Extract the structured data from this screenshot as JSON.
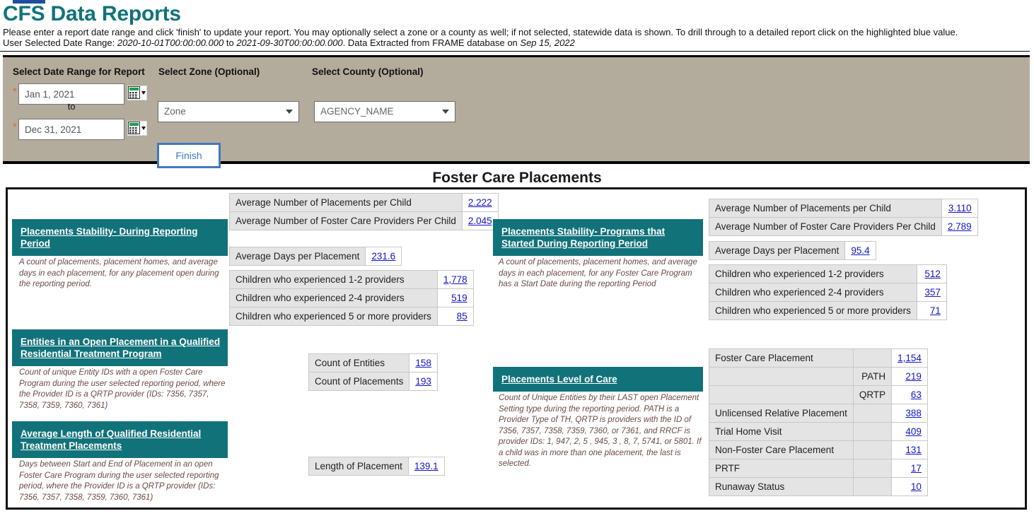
{
  "header": {
    "title": "CFS Data Reports",
    "instructions": "Please enter a report date range and click 'finish' to update your report. You may optionally select a zone or a county as well; if not selected, statewide data is shown. To drill through to a detailed report click on the highlighted blue value.",
    "date_range_prefix": "User Selected Date Range: ",
    "date_range_start": "2020-10-01T00:00:00.000",
    "date_range_joiner": " to ",
    "date_range_end": "2021-09-30T00:00:00.000",
    "extract_prefix": ". Data Extracted from FRAME database on ",
    "extract_date": "Sep 15, 2022",
    "title_color": "#11727a"
  },
  "params": {
    "date_range_label": "Select Date Range for Report",
    "zone_label": "Select Zone (Optional)",
    "county_label": "Select County (Optional)",
    "required_marker": "*",
    "start_date_value": "Jan 1, 2021",
    "start_date_placeholder": "Jan 1, 2021",
    "to_label": "to",
    "end_date_value": "Dec 31, 2021",
    "end_date_placeholder": "Dec 31, 2021",
    "zone_selected": "Zone",
    "county_selected": "AGENCY_NAME",
    "finish_label": "Finish",
    "calendar_icon": "calendar-icon",
    "panel_color": "#b3ab9b",
    "finish_border_color": "#4478be"
  },
  "report": {
    "title": "Foster Care Placements"
  },
  "sections": {
    "stability_during": {
      "heading": "Placements Stability- During Reporting Period",
      "description": "A count of placements, placement homes, and average days in each placement, for any placement open during the reporting period.",
      "avg_table": [
        {
          "label": "Average Number of Placements per Child",
          "value": "2.222"
        },
        {
          "label": "Average Number of Foster Care Providers Per Child",
          "value": "2.045"
        }
      ],
      "days_label": "Average Days per Placement",
      "days_value": "231.6",
      "providers_table": [
        {
          "label": "Children who experienced 1-2 providers",
          "value": "1,778"
        },
        {
          "label": "Children who experienced 2-4 providers",
          "value": "519"
        },
        {
          "label": "Children who experienced 5 or more providers",
          "value": "85"
        }
      ]
    },
    "stability_started": {
      "heading": "Placements Stability- Programs that Started During Reporting Period",
      "description": "A count of placements, placement homes, and average days in each placement, for any Foster Care Program  has a Start Date during the reporting Period",
      "avg_table": [
        {
          "label": "Average Number of Placements per Child",
          "value": "3.110"
        },
        {
          "label": "Average Number of Foster Care Providers Per Child",
          "value": "2.789"
        }
      ],
      "days_label": "Average Days per Placement",
      "days_value": "95.4",
      "providers_table": [
        {
          "label": "Children who experienced 1-2 providers",
          "value": "512"
        },
        {
          "label": "Children who experienced 2-4 providers",
          "value": "357"
        },
        {
          "label": "Children who experienced 5 or more providers",
          "value": "71"
        }
      ]
    },
    "qrtp_entities": {
      "heading": "Entities in an Open Placement in a Qualified Residential Treatment Program",
      "description": "Count of unique Entity IDs with a open Foster Care Program during the user selected reporting period, where the Provider ID is a QRTP provider (IDs: 7356, 7357, 7358, 7359, 7360, 7361)",
      "table": [
        {
          "label": "Count of Entities",
          "value": "158"
        },
        {
          "label": "Count of Placements",
          "value": "193"
        }
      ]
    },
    "qrtp_length": {
      "heading": "Average Length of Qualified Residential Treatment Placements",
      "description": "Days between Start and End of Placement in an open Foster Care Program during the user selected reporting period, where the Provider ID is a QRTP provider (IDs: 7356, 7357, 7358, 7359, 7360, 7361)",
      "label": "Length of Placement",
      "value": "139.1"
    },
    "level_of_care": {
      "heading": "Placements Level of Care",
      "description": "Count of Unique Entities by their LAST open Placement Setting type during the reporting period. PATH is a Provider Type of TH, QRTP is providers with the ID of 7356, 7357, 7358, 7359, 7360, or 7361, and RRCF is provider IDs: 1, 947, 2, 5 , 945, 3 , 8, 7, 5741, or 5801. If a child was in more than one placement, the last is selected.",
      "rows": [
        {
          "label": "Foster Care Placement",
          "sub": "",
          "value": "1,154"
        },
        {
          "label": "",
          "sub": "PATH",
          "value": "219"
        },
        {
          "label": "",
          "sub": "QRTP",
          "value": "63"
        },
        {
          "label": "Unlicensed Relative Placement",
          "sub": "",
          "value": "388"
        },
        {
          "label": "Trial Home Visit",
          "sub": "",
          "value": "409"
        },
        {
          "label": "Non-Foster Care Placement",
          "sub": "",
          "value": "131"
        },
        {
          "label": "PRTF",
          "sub": "",
          "value": "17"
        },
        {
          "label": "Runaway Status",
          "sub": "",
          "value": "10"
        }
      ]
    }
  }
}
